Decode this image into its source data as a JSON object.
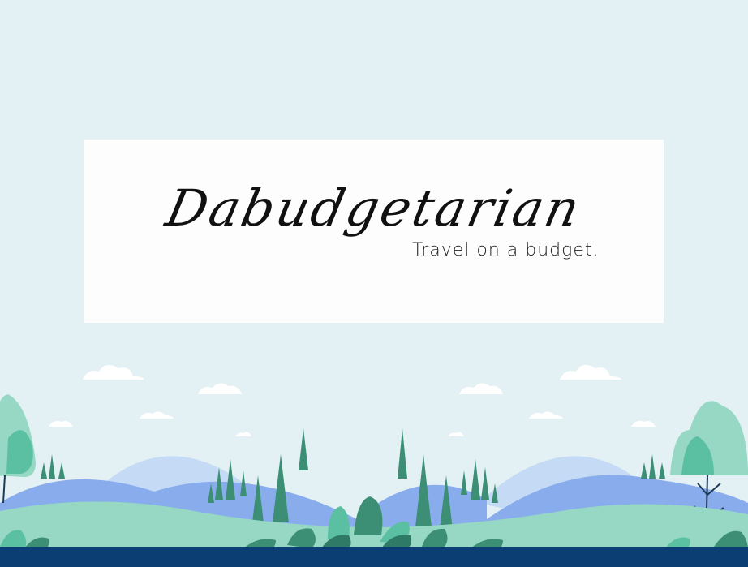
{
  "site": {
    "logo_script": "Dabudgetarian",
    "tagline": "Travel on a budget."
  },
  "colors": {
    "background": "#e3f1f4",
    "card": "#fdfdfd",
    "hill_light": "#c5dbf5",
    "hill_mid": "#89acec",
    "ground": "#96d8c4",
    "tree": "#3c8f74",
    "bottom_bar": "#0b3f73"
  },
  "icons": [
    "cloud-icon",
    "pine-tree-icon",
    "round-tree-icon",
    "leaf-plant-icon"
  ]
}
